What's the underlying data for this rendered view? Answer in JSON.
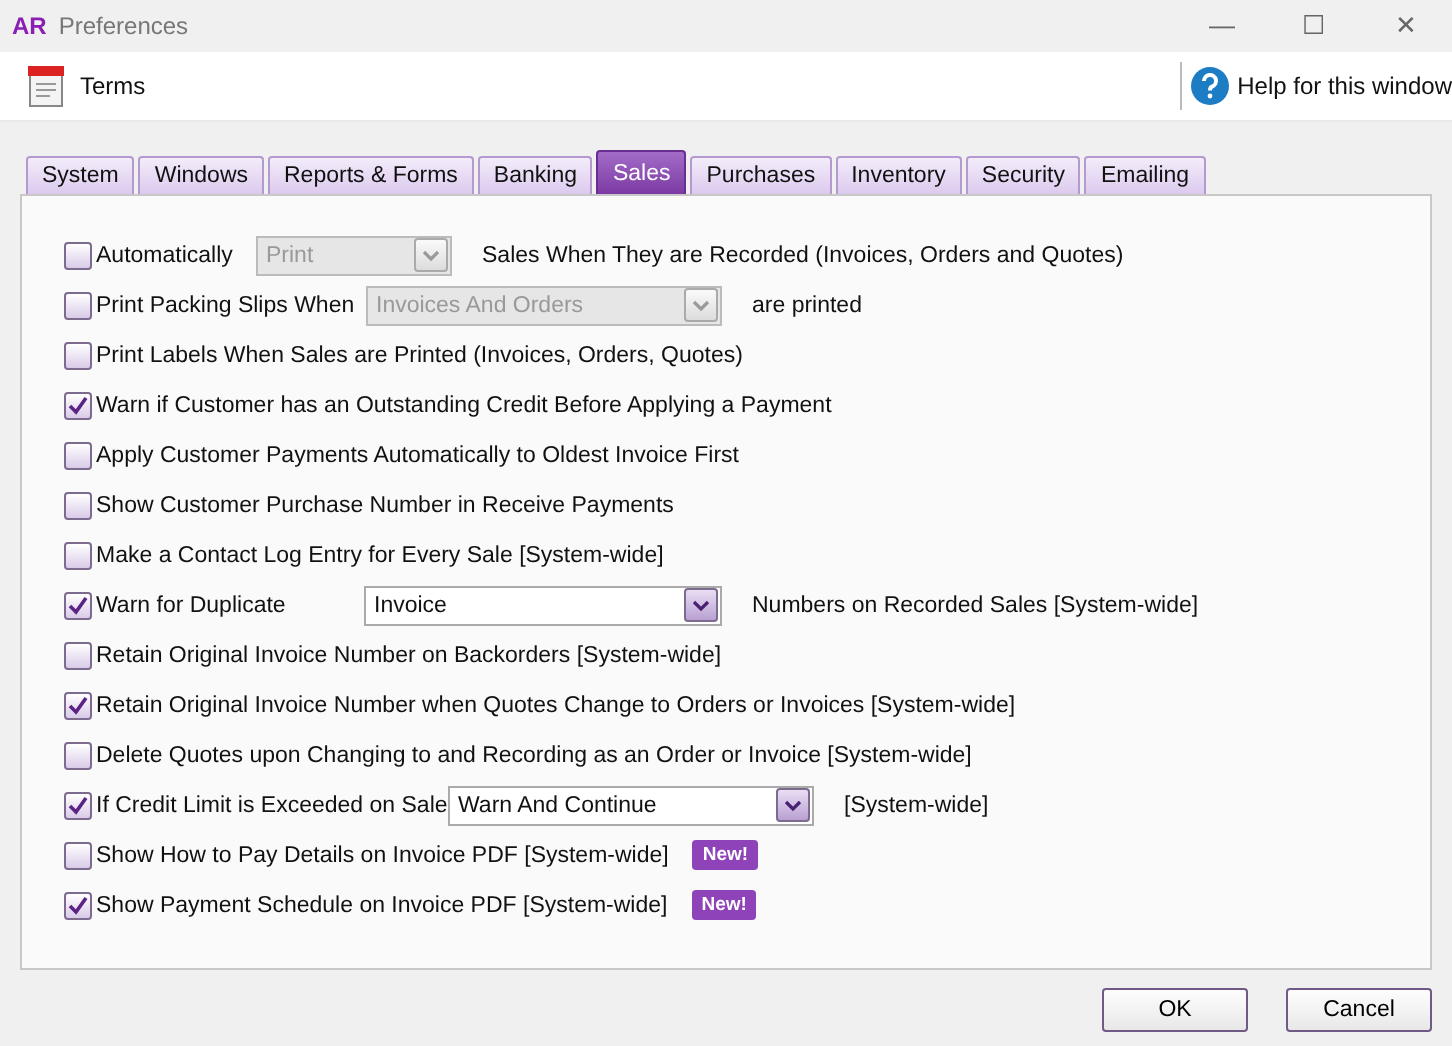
{
  "window": {
    "logo": "AR",
    "title": "Preferences",
    "controls": [
      "—",
      "☐",
      "✕"
    ]
  },
  "toolbar": {
    "terms": "Terms",
    "help": "Help for this window"
  },
  "tabs": [
    {
      "label": "System",
      "selected": false
    },
    {
      "label": "Windows",
      "selected": false
    },
    {
      "label": "Reports & Forms",
      "selected": false
    },
    {
      "label": "Banking",
      "selected": false
    },
    {
      "label": "Sales",
      "selected": true
    },
    {
      "label": "Purchases",
      "selected": false
    },
    {
      "label": "Inventory",
      "selected": false
    },
    {
      "label": "Security",
      "selected": false
    },
    {
      "label": "Emailing",
      "selected": false
    }
  ],
  "options": [
    {
      "kind": "select",
      "label": "Automatically",
      "checked": false,
      "select": {
        "value": "Print",
        "disabled": true
      },
      "suffix": "Sales When They are Recorded (Invoices, Orders and Quotes)"
    },
    {
      "kind": "select",
      "label": "Print Packing Slips When",
      "checked": false,
      "select": {
        "value": "Invoices And Orders",
        "disabled": true
      },
      "suffix": "are printed"
    },
    {
      "kind": "check",
      "label": "Print Labels When Sales are Printed (Invoices, Orders, Quotes)",
      "checked": false
    },
    {
      "kind": "check",
      "label": "Warn if Customer has an Outstanding Credit Before Applying a Payment",
      "checked": true
    },
    {
      "kind": "check",
      "label": "Apply Customer Payments Automatically to Oldest Invoice First",
      "checked": false
    },
    {
      "kind": "check",
      "label": "Show Customer Purchase Number in Receive Payments",
      "checked": false
    },
    {
      "kind": "check",
      "label": "Make a Contact Log Entry for Every Sale [System-wide]",
      "checked": false
    },
    {
      "kind": "select",
      "label": "Warn for Duplicate",
      "checked": true,
      "select": {
        "value": "Invoice",
        "disabled": false
      },
      "suffix": "Numbers on Recorded Sales [System-wide]"
    },
    {
      "kind": "check",
      "label": "Retain Original Invoice Number on Backorders [System-wide]",
      "checked": false
    },
    {
      "kind": "check",
      "label": "Retain Original Invoice Number when Quotes Change to Orders or Invoices [System-wide]",
      "checked": true
    },
    {
      "kind": "check",
      "label": "Delete Quotes upon Changing to and Recording as an Order or Invoice [System-wide]",
      "checked": false
    },
    {
      "kind": "select",
      "label": "If Credit Limit is Exceeded on Sale",
      "checked": true,
      "select": {
        "value": "Warn And Continue",
        "disabled": false
      },
      "suffix": "[System-wide]"
    },
    {
      "kind": "badge",
      "label": "Show How to Pay Details on Invoice PDF [System-wide]",
      "checked": false,
      "badge": "New!"
    },
    {
      "kind": "badge",
      "label": "Show Payment Schedule on Invoice PDF [System-wide]",
      "checked": true,
      "badge": "New!"
    }
  ],
  "buttons": [
    "OK",
    "Cancel"
  ]
}
